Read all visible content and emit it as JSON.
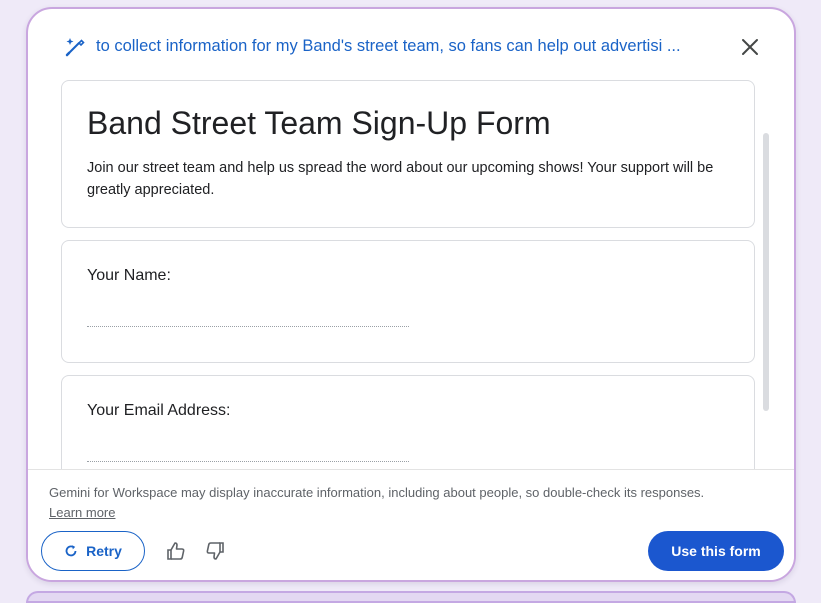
{
  "header": {
    "prompt_text": "to collect information for my Band's street team, so fans can help out advertisi ...",
    "sparkle_icon": "sparkle-pen-icon",
    "close_icon": "close-icon"
  },
  "form": {
    "title": "Band Street Team Sign-Up Form",
    "description": "Join our street team and help us spread the word about our upcoming shows! Your support will be greatly appreciated.",
    "questions": [
      {
        "label": "Your Name:"
      },
      {
        "label": "Your Email Address:"
      }
    ]
  },
  "footer": {
    "disclaimer": "Gemini for Workspace may display inaccurate information, including about people, so double-check its responses.",
    "learn_more": "Learn more",
    "retry_label": "Retry",
    "use_form_label": "Use this form"
  },
  "colors": {
    "accent": "#1a63c7",
    "primary_button": "#1b57cf",
    "panel_border": "#c9a6df"
  }
}
